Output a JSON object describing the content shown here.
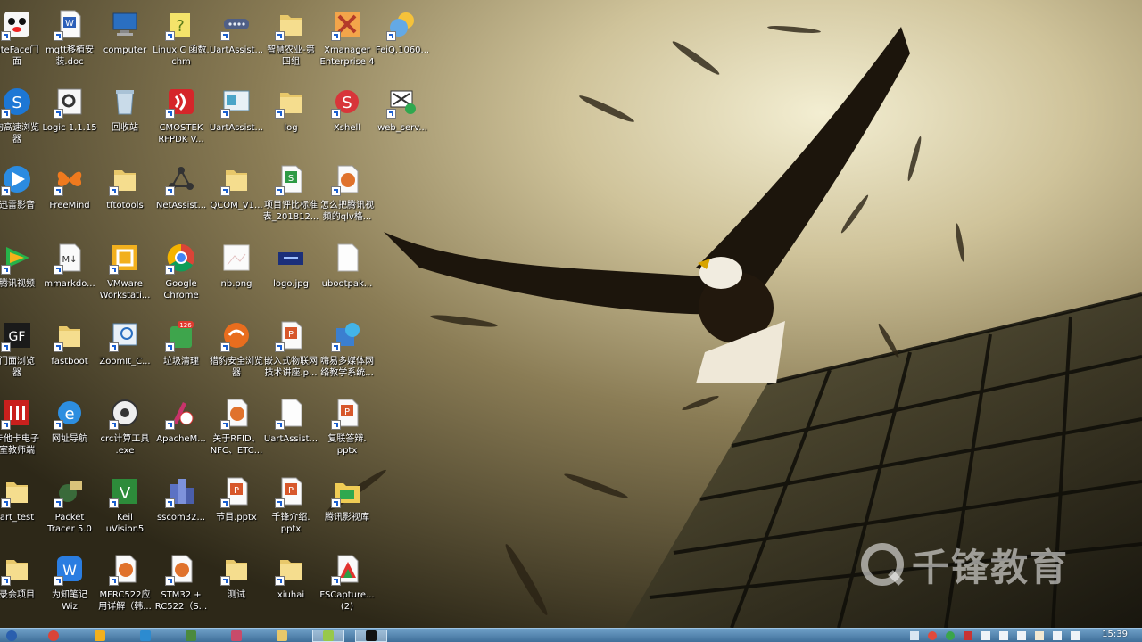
{
  "desktop": {
    "icons": [
      {
        "label": "ateFace门\n面",
        "name": "desktop-icon-ateface"
      },
      {
        "label": "mqtt移植安\n装.doc",
        "name": "desktop-icon-mqtt-doc"
      },
      {
        "label": "computer",
        "name": "desktop-icon-computer"
      },
      {
        "label": "Linux C 函数.\nchm",
        "name": "desktop-icon-linux-c-chm"
      },
      {
        "label": "UartAssist...",
        "name": "desktop-icon-uartassist-1"
      },
      {
        "label": "智慧农业-第\n四组",
        "name": "desktop-icon-smart-agriculture"
      },
      {
        "label": "Xmanager\nEnterprise 4",
        "name": "desktop-icon-xmanager"
      },
      {
        "label": "FeiQ.1060...",
        "name": "desktop-icon-feiq"
      },
      {
        "label": "狗高速浏览\n器",
        "name": "desktop-icon-sogou-browser"
      },
      {
        "label": "Logic 1.1.15",
        "name": "desktop-icon-logic"
      },
      {
        "label": "回收站",
        "name": "desktop-icon-recycle-bin"
      },
      {
        "label": "CMOSTEK\nRFPDK V...",
        "name": "desktop-icon-cmostek"
      },
      {
        "label": "UartAssist...",
        "name": "desktop-icon-uartassist-2"
      },
      {
        "label": "log",
        "name": "desktop-icon-log"
      },
      {
        "label": "Xshell",
        "name": "desktop-icon-xshell"
      },
      {
        "label": "web_serv...",
        "name": "desktop-icon-web-serv"
      },
      {
        "label": "迅雷影音",
        "name": "desktop-icon-xunlei"
      },
      {
        "label": "FreeMind",
        "name": "desktop-icon-freemind"
      },
      {
        "label": "tftotools",
        "name": "desktop-icon-tftotools"
      },
      {
        "label": "NetAssist...",
        "name": "desktop-icon-netassist"
      },
      {
        "label": "QCOM_V1...",
        "name": "desktop-icon-qcom"
      },
      {
        "label": "项目评比标准\n表_201812...",
        "name": "desktop-icon-project-xls"
      },
      {
        "label": "怎么把腾讯视\n频的qlv格...",
        "name": "desktop-icon-qlv-doc"
      },
      {
        "label": "腾讯视频",
        "name": "desktop-icon-tencent-video"
      },
      {
        "label": "mmarkdo...",
        "name": "desktop-icon-mmarkdown"
      },
      {
        "label": "VMware\nWorkstati...",
        "name": "desktop-icon-vmware"
      },
      {
        "label": "Google\nChrome",
        "name": "desktop-icon-chrome"
      },
      {
        "label": "nb.png",
        "name": "desktop-icon-nb-png"
      },
      {
        "label": "logo.jpg",
        "name": "desktop-icon-logo-jpg"
      },
      {
        "label": "ubootpak...",
        "name": "desktop-icon-ubootpak"
      },
      {
        "label": "门面浏览\n器",
        "name": "desktop-icon-gf-browser"
      },
      {
        "label": "fastboot",
        "name": "desktop-icon-fastboot"
      },
      {
        "label": "ZoomIt_C...",
        "name": "desktop-icon-zoomit"
      },
      {
        "label": "垃圾清理",
        "name": "desktop-icon-cleaner"
      },
      {
        "label": "猎豹安全浏览\n器",
        "name": "desktop-icon-liebao"
      },
      {
        "label": "嵌入式物联网\n技术讲座.p...",
        "name": "desktop-icon-iot-ppt"
      },
      {
        "label": "嗨易多媒体网\n络教学系统...",
        "name": "desktop-icon-multimedia"
      },
      {
        "label": "卡他卡电子\n室教师端",
        "name": "desktop-icon-teacher"
      },
      {
        "label": "网址导航",
        "name": "desktop-icon-ie-nav"
      },
      {
        "label": "crc计算工具\n.exe",
        "name": "desktop-icon-crc"
      },
      {
        "label": "ApacheM...",
        "name": "desktop-icon-apache"
      },
      {
        "label": "关于RFID、\nNFC、ETC...",
        "name": "desktop-icon-rfid"
      },
      {
        "label": "UartAssist...",
        "name": "desktop-icon-uartassist-3"
      },
      {
        "label": "复联答辩.\npptx",
        "name": "desktop-icon-fulian-pptx"
      },
      {
        "label": "art_test",
        "name": "desktop-icon-art-test"
      },
      {
        "label": "Packet\nTracer 5.0",
        "name": "desktop-icon-packet-tracer"
      },
      {
        "label": "Keil\nuVision5",
        "name": "desktop-icon-keil"
      },
      {
        "label": "sscom32...",
        "name": "desktop-icon-sscom"
      },
      {
        "label": "节目.pptx",
        "name": "desktop-icon-jiemu-pptx"
      },
      {
        "label": "千锋介绍.\npptx",
        "name": "desktop-icon-qianfeng-pptx"
      },
      {
        "label": "腾讯影视库",
        "name": "desktop-icon-tencent-lib"
      },
      {
        "label": "录会项目",
        "name": "desktop-icon-project-folder"
      },
      {
        "label": "为知笔记\nWiz",
        "name": "desktop-icon-wiz"
      },
      {
        "label": "MFRC522应\n用详解（韩...",
        "name": "desktop-icon-mfrc522"
      },
      {
        "label": "STM32 +\nRC522（S...",
        "name": "desktop-icon-stm32"
      },
      {
        "label": "测试",
        "name": "desktop-icon-test-folder"
      },
      {
        "label": "xiuhai",
        "name": "desktop-icon-xiuhai"
      },
      {
        "label": "FSCapture...\n(2)",
        "name": "desktop-icon-fscapture"
      }
    ]
  },
  "watermark": {
    "text": "千锋教育",
    "icon": "qianfeng-logo-icon"
  },
  "taskbar": {
    "buttons": [
      {
        "name": "taskbar-start-button",
        "icon": "windows-start-icon"
      },
      {
        "name": "taskbar-chrome",
        "icon": "chrome-icon"
      },
      {
        "name": "taskbar-vmware",
        "icon": "vmware-icon"
      },
      {
        "name": "taskbar-xmind",
        "icon": "xmind-icon"
      },
      {
        "name": "taskbar-app-4",
        "icon": "app-icon"
      },
      {
        "name": "taskbar-app-5",
        "icon": "app-icon"
      },
      {
        "name": "taskbar-explorer",
        "icon": "folder-icon"
      },
      {
        "name": "taskbar-app-7",
        "icon": "app-icon"
      },
      {
        "name": "taskbar-app-8",
        "icon": "app-icon"
      }
    ],
    "clock": "15:39"
  }
}
